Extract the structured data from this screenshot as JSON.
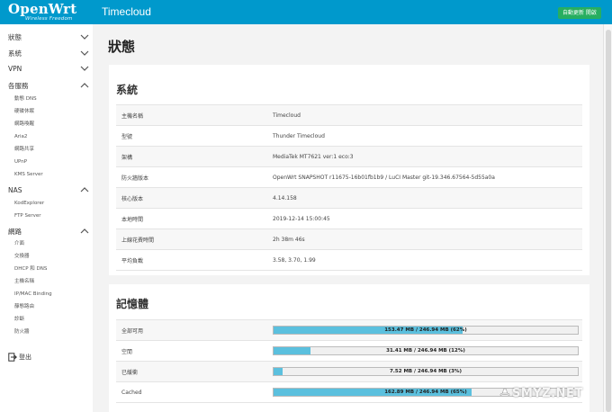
{
  "header": {
    "brand": "OpenWrt",
    "brand_sub": "Wireless Freedom",
    "hostname": "Timecloud",
    "refresh_label": "自動更新 開啟",
    "color": "#0099cc"
  },
  "sidebar": {
    "groups": [
      {
        "label": "狀態",
        "expanded": false
      },
      {
        "label": "系統",
        "expanded": false
      },
      {
        "label": "VPN",
        "expanded": false
      },
      {
        "label": "各服務",
        "expanded": true
      },
      {
        "label": "NAS",
        "expanded": true
      },
      {
        "label": "網路",
        "expanded": true
      }
    ],
    "services_items": [
      "動態 DNS",
      "硬碟休眠",
      "網路喚醒",
      "Aria2",
      "網路共享",
      "UPnP",
      "KMS Server"
    ],
    "nas_items": [
      "KodExplorer",
      "FTP Server"
    ],
    "network_items": [
      "介面",
      "交換器",
      "DHCP 和 DNS",
      "主機名稱",
      "IP/MAC Binding",
      "靜態路由",
      "診斷",
      "防火牆"
    ],
    "logout_label": "登出"
  },
  "main": {
    "title": "狀態",
    "system": {
      "title": "系統",
      "rows": [
        {
          "label": "主機名稱",
          "value": "Timecloud"
        },
        {
          "label": "型號",
          "value": "Thunder Timecloud"
        },
        {
          "label": "架構",
          "value": "MediaTek MT7621 ver:1 eco:3"
        },
        {
          "label": "防火牆版本",
          "value": "OpenWrt SNAPSHOT r11675-16b01fb1b9 / LuCI Master git-19.346.67564-5d55a0a"
        },
        {
          "label": "核心版本",
          "value": "4.14.158"
        },
        {
          "label": "本地時間",
          "value": "2019-12-14 15:00:45"
        },
        {
          "label": "上線花費時間",
          "value": "2h 38m 46s"
        },
        {
          "label": "平均負載",
          "value": "3.58, 3.70, 1.99"
        }
      ]
    },
    "memory": {
      "title": "記憶體",
      "rows": [
        {
          "label": "全部可用",
          "text": "153.47 MB / 246.94 MB (62%)",
          "percent": 62
        },
        {
          "label": "空閒",
          "text": "31.41 MB / 246.94 MB (12%)",
          "percent": 12
        },
        {
          "label": "已緩衝",
          "text": "7.52 MB / 246.94 MB (3%)",
          "percent": 3
        },
        {
          "label": "Cached",
          "text": "162.89 MB / 246.94 MB (65%)",
          "percent": 65
        }
      ],
      "bar_color": "#5bc0de"
    }
  },
  "watermark": "SMYZ.NET",
  "icons": {
    "chevron": "chevron-icon",
    "logout": "logout-icon"
  }
}
